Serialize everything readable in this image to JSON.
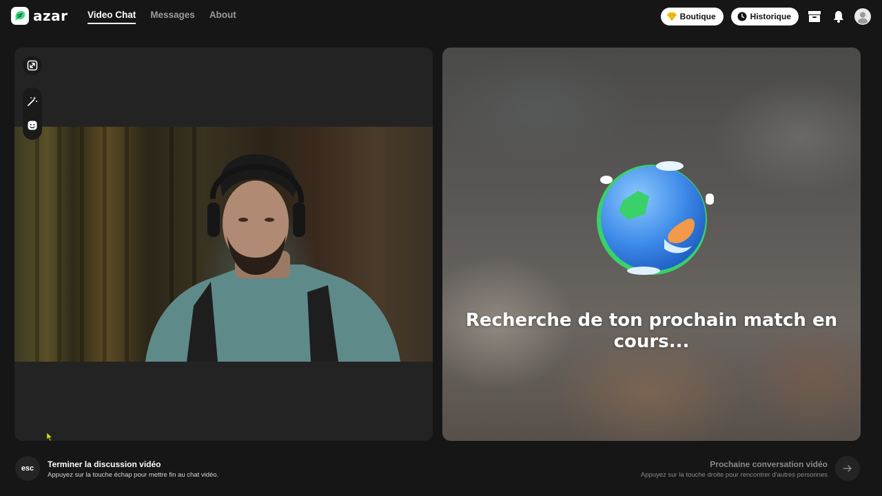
{
  "app": {
    "logo_text": "azar"
  },
  "nav": {
    "items": [
      {
        "label": "Video Chat",
        "active": true
      },
      {
        "label": "Messages",
        "active": false
      },
      {
        "label": "About",
        "active": false
      }
    ]
  },
  "header": {
    "boutique_label": "Boutique",
    "historique_label": "Historique",
    "icons": [
      "diamond-icon",
      "clock-icon",
      "store-icon",
      "bell-icon",
      "avatar-icon"
    ]
  },
  "left_panel": {
    "controls": [
      "expand-icon",
      "magic-wand-icon",
      "face-sticker-icon"
    ]
  },
  "right_panel": {
    "search_text": "Recherche de ton prochain match en cours..."
  },
  "footer": {
    "esc_label": "esc",
    "end_title": "Terminer la discussion vidéo",
    "end_subtitle": "Appuyez sur la touche échap pour mettre fin au chat vidéo.",
    "next_title": "Prochaine conversation vidéo",
    "next_subtitle": "Appuyez sur la touche droite pour rencontrer d'autres personnes"
  },
  "colors": {
    "accent": "#3ddc84",
    "background": "#161616",
    "panel": "#232323"
  }
}
